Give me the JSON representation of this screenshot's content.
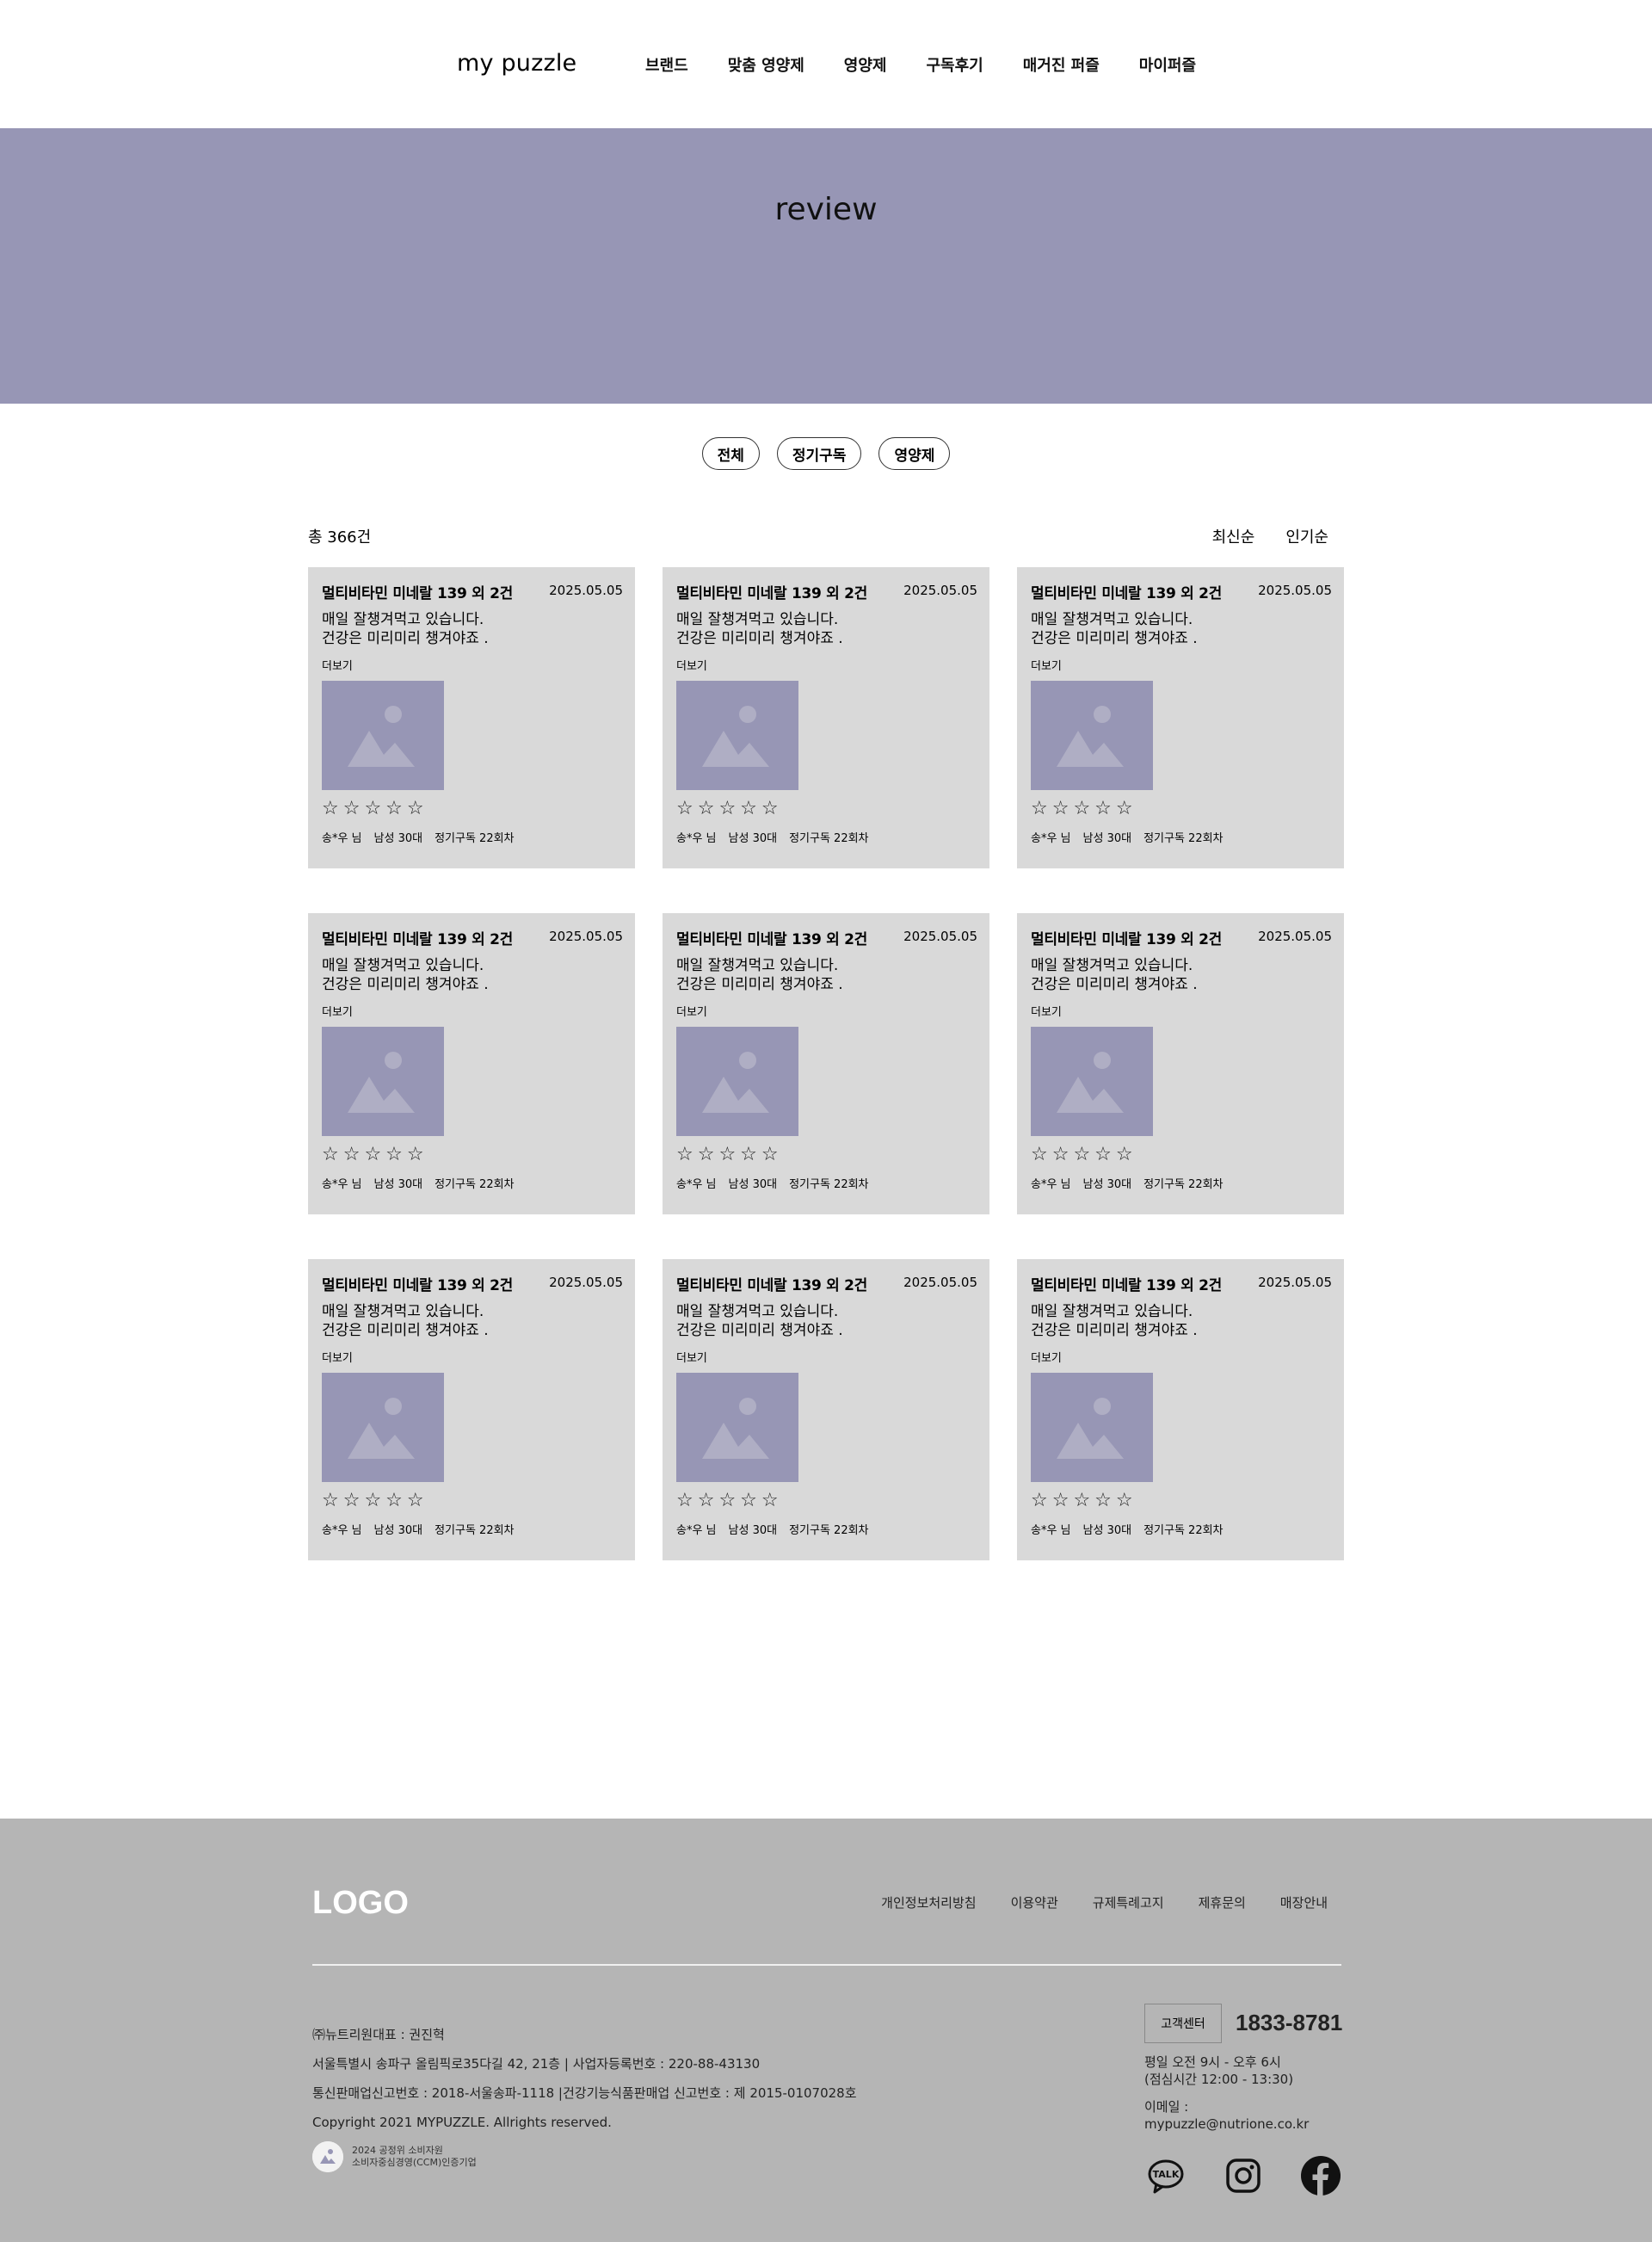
{
  "header": {
    "logo": "my puzzle",
    "nav": [
      "브랜드",
      "맞춤 영양제",
      "영양제",
      "구독후기",
      "매거진 퍼즐",
      "마이퍼즐"
    ]
  },
  "hero": {
    "title": "review"
  },
  "filters": [
    "전체",
    "정기구독",
    "영양제"
  ],
  "summary": {
    "total": "총 366건",
    "sort": [
      "최신순",
      "인기순"
    ]
  },
  "reviews": [
    {
      "title": "멀티비타민 미네랄 139 외 2건",
      "date": "2025.05.05",
      "line1": "매일 잘챙겨먹고 있습니다.",
      "line2": "건강은 미리미리 챙겨야죠 .",
      "more": "더보기",
      "stars": "☆☆☆☆☆",
      "rating": 0,
      "user": "송*우 님",
      "profile": "남성 30대",
      "sub": "정기구독 22회차"
    },
    {
      "title": "멀티비타민 미네랄 139 외 2건",
      "date": "2025.05.05",
      "line1": "매일 잘챙겨먹고 있습니다.",
      "line2": "건강은 미리미리 챙겨야죠 .",
      "more": "더보기",
      "stars": "☆☆☆☆☆",
      "rating": 0,
      "user": "송*우 님",
      "profile": "남성 30대",
      "sub": "정기구독 22회차"
    },
    {
      "title": "멀티비타민 미네랄 139 외 2건",
      "date": "2025.05.05",
      "line1": "매일 잘챙겨먹고 있습니다.",
      "line2": "건강은 미리미리 챙겨야죠 .",
      "more": "더보기",
      "stars": "☆☆☆☆☆",
      "rating": 0,
      "user": "송*우 님",
      "profile": "남성 30대",
      "sub": "정기구독 22회차"
    },
    {
      "title": "멀티비타민 미네랄 139 외 2건",
      "date": "2025.05.05",
      "line1": "매일 잘챙겨먹고 있습니다.",
      "line2": "건강은 미리미리 챙겨야죠 .",
      "more": "더보기",
      "stars": "☆☆☆☆☆",
      "rating": 0,
      "user": "송*우 님",
      "profile": "남성 30대",
      "sub": "정기구독 22회차"
    },
    {
      "title": "멀티비타민 미네랄 139 외 2건",
      "date": "2025.05.05",
      "line1": "매일 잘챙겨먹고 있습니다.",
      "line2": "건강은 미리미리 챙겨야죠 .",
      "more": "더보기",
      "stars": "☆☆☆☆☆",
      "rating": 0,
      "user": "송*우 님",
      "profile": "남성 30대",
      "sub": "정기구독 22회차"
    },
    {
      "title": "멀티비타민 미네랄 139 외 2건",
      "date": "2025.05.05",
      "line1": "매일 잘챙겨먹고 있습니다.",
      "line2": "건강은 미리미리 챙겨야죠 .",
      "more": "더보기",
      "stars": "☆☆☆☆☆",
      "rating": 0,
      "user": "송*우 님",
      "profile": "남성 30대",
      "sub": "정기구독 22회차"
    },
    {
      "title": "멀티비타민 미네랄 139 외 2건",
      "date": "2025.05.05",
      "line1": "매일 잘챙겨먹고 있습니다.",
      "line2": "건강은 미리미리 챙겨야죠 .",
      "more": "더보기",
      "stars": "☆☆☆☆☆",
      "rating": 0,
      "user": "송*우 님",
      "profile": "남성 30대",
      "sub": "정기구독 22회차"
    },
    {
      "title": "멀티비타민 미네랄 139 외 2건",
      "date": "2025.05.05",
      "line1": "매일 잘챙겨먹고 있습니다.",
      "line2": "건강은 미리미리 챙겨야죠 .",
      "more": "더보기",
      "stars": "☆☆☆☆☆",
      "rating": 0,
      "user": "송*우 님",
      "profile": "남성 30대",
      "sub": "정기구독 22회차"
    },
    {
      "title": "멀티비타민 미네랄 139 외 2건",
      "date": "2025.05.05",
      "line1": "매일 잘챙겨먹고 있습니다.",
      "line2": "건강은 미리미리 챙겨야죠 .",
      "more": "더보기",
      "stars": "☆☆☆☆☆",
      "rating": 0,
      "user": "송*우 님",
      "profile": "남성 30대",
      "sub": "정기구독 22회차"
    }
  ],
  "footer": {
    "logo": "LOGO",
    "links": [
      "개인정보처리방침",
      "이용약관",
      "규제특례고지",
      "제휴문의",
      "매장안내"
    ],
    "info": [
      "㈜뉴트리원대표 : 권진혁",
      "서울특별시 송파구 올림픽로35다길 42, 21층 | 사업자등록번호 : 220-88-43130",
      "통신판매업신고번호 : 2018-서울송파-1118 |건강기능식품판매업 신고번호 : 제 2015-0107028호",
      "Copyright 2021 MYPUZZLE. Allrights reserved."
    ],
    "ccm_line1": "2024 공정위 소비자원",
    "ccm_line2": "소비자중심경영(CCM)인증기업",
    "cs_label": "고객센터",
    "cs_phone": "1833-8781",
    "cs_hours1": "평일 오전 9시 - 오후 6시",
    "cs_hours2": "(점심시간 12:00 - 13:30)",
    "cs_email_label": "이메일 :",
    "cs_email": "mypuzzle@nutrione.co.kr",
    "social_icons": [
      "kakaotalk-icon",
      "instagram-icon",
      "facebook-icon"
    ],
    "talk_label": "TALK"
  },
  "colors": {
    "accent": "#9796b5",
    "card_bg": "#d9d9d9",
    "footer_bg": "#b5b5b5"
  }
}
